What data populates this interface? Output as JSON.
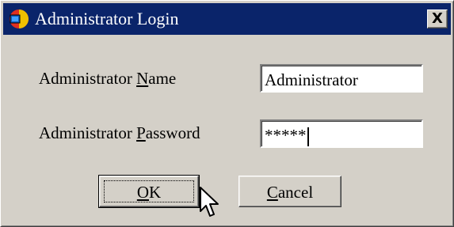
{
  "window": {
    "title": "Administrator Login",
    "close_label": "X",
    "icon": "app-logo-icon"
  },
  "form": {
    "name_label_before": "Administrator ",
    "name_label_accel": "N",
    "name_label_after": "ame",
    "name_value": "Administrator",
    "password_label_before": "Administrator ",
    "password_label_accel": "P",
    "password_label_after": "assword",
    "password_value": "*****"
  },
  "buttons": {
    "ok_accel": "O",
    "ok_rest": "K",
    "cancel_accel": "C",
    "cancel_rest": "ancel"
  },
  "colors": {
    "titlebar": "#0a246a",
    "dialog_face": "#d4d0c8"
  }
}
